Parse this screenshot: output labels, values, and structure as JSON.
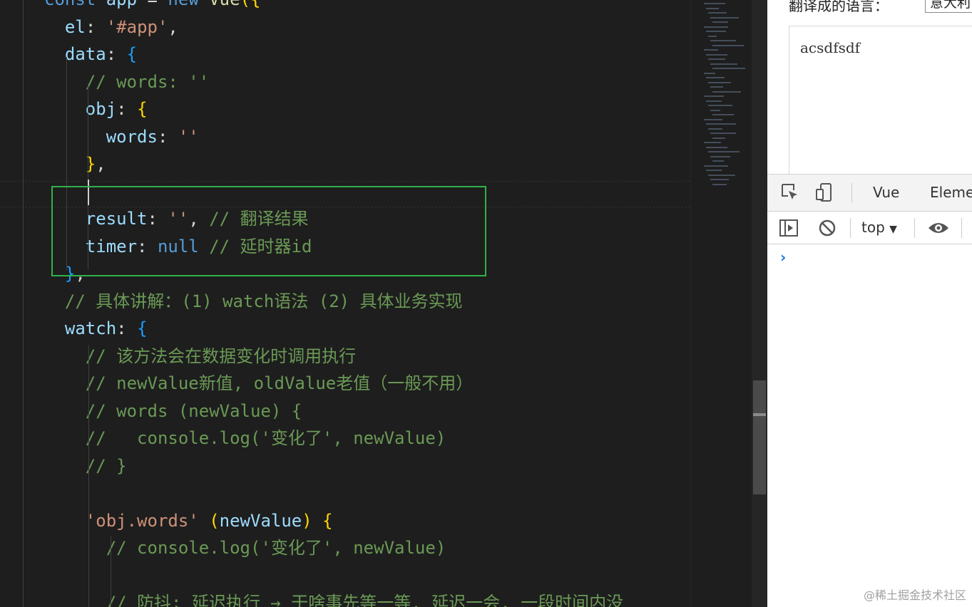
{
  "editor": {
    "lines": [
      {
        "id": "l0",
        "tokens": [
          [
            "t-kw",
            "const "
          ],
          [
            "t-prop",
            "app"
          ],
          [
            "t-pl",
            " = "
          ],
          [
            "t-kw",
            "new "
          ],
          [
            "t-fn",
            "Vue"
          ],
          [
            "t-br1",
            "({"
          ]
        ]
      },
      {
        "id": "l1",
        "tokens": [
          [
            "t-pl",
            "  "
          ],
          [
            "t-prop",
            "el"
          ],
          [
            "t-pl",
            ": "
          ],
          [
            "t-str",
            "'#app'"
          ],
          [
            "t-pl",
            ","
          ]
        ]
      },
      {
        "id": "l2",
        "tokens": [
          [
            "t-pl",
            "  "
          ],
          [
            "t-prop",
            "data"
          ],
          [
            "t-pl",
            ": "
          ],
          [
            "t-br3",
            "{"
          ]
        ]
      },
      {
        "id": "l3",
        "tokens": [
          [
            "t-pl",
            "    "
          ],
          [
            "t-cm",
            "// words: ''"
          ]
        ]
      },
      {
        "id": "l4",
        "tokens": [
          [
            "t-pl",
            "    "
          ],
          [
            "t-prop",
            "obj"
          ],
          [
            "t-pl",
            ": "
          ],
          [
            "t-br1",
            "{"
          ]
        ]
      },
      {
        "id": "l5",
        "tokens": [
          [
            "t-pl",
            "      "
          ],
          [
            "t-prop",
            "words"
          ],
          [
            "t-pl",
            ": "
          ],
          [
            "t-str",
            "''"
          ]
        ]
      },
      {
        "id": "l6",
        "tokens": [
          [
            "t-pl",
            "    "
          ],
          [
            "t-br1",
            "}"
          ],
          [
            "t-pl",
            ","
          ]
        ]
      },
      {
        "id": "l7",
        "tokens": [
          [
            "t-pl",
            ""
          ]
        ]
      },
      {
        "id": "l8",
        "tokens": [
          [
            "t-pl",
            "    "
          ],
          [
            "t-prop",
            "result"
          ],
          [
            "t-pl",
            ": "
          ],
          [
            "t-str",
            "''"
          ],
          [
            "t-pl",
            ", "
          ],
          [
            "t-cm",
            "// 翻译结果"
          ]
        ]
      },
      {
        "id": "l9",
        "tokens": [
          [
            "t-pl",
            "    "
          ],
          [
            "t-prop",
            "timer"
          ],
          [
            "t-pl",
            ": "
          ],
          [
            "t-null",
            "null"
          ],
          [
            "t-pl",
            " "
          ],
          [
            "t-cm",
            "// 延时器id"
          ]
        ]
      },
      {
        "id": "l10",
        "tokens": [
          [
            "t-pl",
            "  "
          ],
          [
            "t-br3",
            "}"
          ],
          [
            "t-pl",
            ","
          ]
        ]
      },
      {
        "id": "l11",
        "tokens": [
          [
            "t-pl",
            "  "
          ],
          [
            "t-cm",
            "// 具体讲解：(1) watch语法 (2) 具体业务实现"
          ]
        ]
      },
      {
        "id": "l12",
        "tokens": [
          [
            "t-pl",
            "  "
          ],
          [
            "t-prop",
            "watch"
          ],
          [
            "t-pl",
            ": "
          ],
          [
            "t-br3",
            "{"
          ]
        ]
      },
      {
        "id": "l13",
        "tokens": [
          [
            "t-pl",
            "    "
          ],
          [
            "t-cm",
            "// 该方法会在数据变化时调用执行"
          ]
        ]
      },
      {
        "id": "l14",
        "tokens": [
          [
            "t-pl",
            "    "
          ],
          [
            "t-cm",
            "// newValue新值, oldValue老值（一般不用）"
          ]
        ]
      },
      {
        "id": "l15",
        "tokens": [
          [
            "t-pl",
            "    "
          ],
          [
            "t-cm",
            "// words (newValue) {"
          ]
        ]
      },
      {
        "id": "l16",
        "tokens": [
          [
            "t-pl",
            "    "
          ],
          [
            "t-cm",
            "//   console.log('变化了', newValue)"
          ]
        ]
      },
      {
        "id": "l17",
        "tokens": [
          [
            "t-pl",
            "    "
          ],
          [
            "t-cm",
            "// }"
          ]
        ]
      },
      {
        "id": "l18",
        "tokens": [
          [
            "t-pl",
            ""
          ]
        ]
      },
      {
        "id": "l19",
        "tokens": [
          [
            "t-pl",
            "    "
          ],
          [
            "t-str",
            "'obj.words'"
          ],
          [
            "t-pl",
            " "
          ],
          [
            "t-br1",
            "("
          ],
          [
            "t-prop",
            "newValue"
          ],
          [
            "t-br1",
            ")"
          ],
          [
            "t-pl",
            " "
          ],
          [
            "t-br1",
            "{"
          ]
        ]
      },
      {
        "id": "l20",
        "tokens": [
          [
            "t-pl",
            "      "
          ],
          [
            "t-cm",
            "// console.log('变化了', newValue)"
          ]
        ]
      },
      {
        "id": "l21",
        "tokens": [
          [
            "t-pl",
            ""
          ]
        ]
      },
      {
        "id": "l22",
        "tokens": [
          [
            "t-pl",
            "      "
          ],
          [
            "t-cm",
            "// 防抖: 延迟执行 → 干啥事先等一等, 延迟一会, 一段时间内没"
          ]
        ]
      }
    ]
  },
  "browser": {
    "language_label": "翻译成的语言：",
    "language_value": "意大利",
    "source_text": "acsdfsdf"
  },
  "devtools": {
    "tabs": [
      "Vue",
      "Eleme"
    ],
    "context": "top",
    "prompt": "›"
  },
  "watermark": "@稀土掘金技术社区",
  "colors": {
    "editor_bg": "#1e1e1e",
    "highlight_box": "#2fb24a",
    "keyword": "#569cd6",
    "property": "#9cdcfe",
    "string": "#ce9178",
    "comment": "#6a9955"
  }
}
